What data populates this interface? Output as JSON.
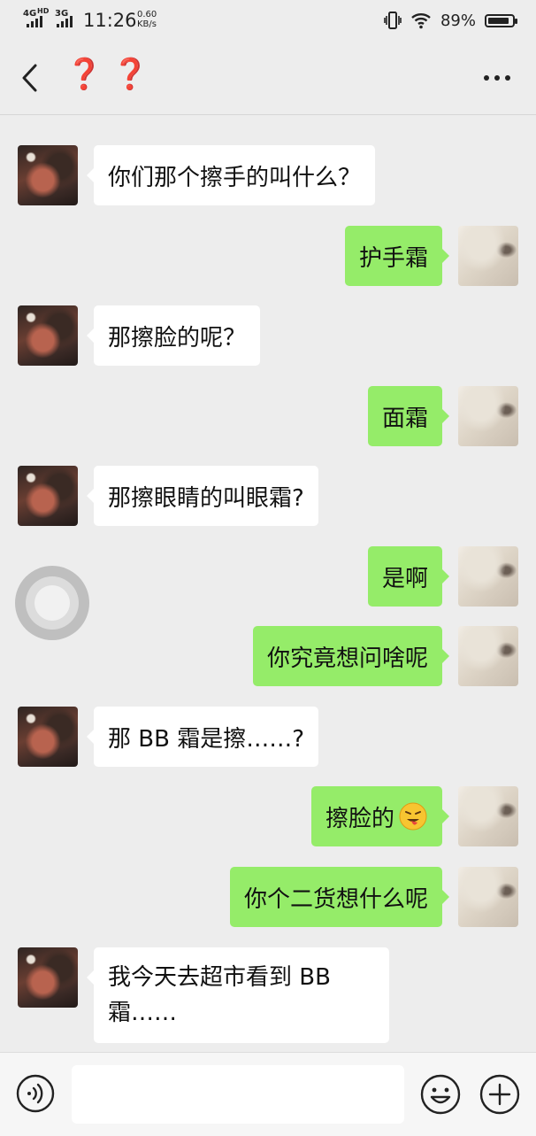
{
  "status_bar": {
    "network1": "4G",
    "network1_hd": "HD",
    "network2": "3G",
    "time": "11:26",
    "speed_value": "0.60",
    "speed_unit": "KB/s",
    "battery_pct": "89%",
    "battery_level": 0.89
  },
  "header": {
    "title": "❓❓",
    "back_icon": "chevron-left-icon",
    "more_icon": "more-dots-icon"
  },
  "messages": [
    {
      "side": "in",
      "text": "你们那个擦手的叫什么？"
    },
    {
      "side": "out",
      "text": "护手霜"
    },
    {
      "side": "in",
      "text": "那擦脸的呢？"
    },
    {
      "side": "out",
      "text": "面霜"
    },
    {
      "side": "in",
      "text": "那擦眼睛的叫眼霜?"
    },
    {
      "side": "out",
      "text": "是啊"
    },
    {
      "side": "out",
      "text": "你究竟想问啥呢"
    },
    {
      "side": "in",
      "text": "那 BB 霜是擦……?"
    },
    {
      "side": "out",
      "text": "擦脸的",
      "emoji": "grimacing-tongue-emoji"
    },
    {
      "side": "out",
      "text": "你个二货想什么呢"
    },
    {
      "side": "in",
      "text": "我今天去超市看到 BB 霜……"
    }
  ],
  "input_bar": {
    "voice_icon": "voice-icon",
    "text_value": "",
    "emoji_icon": "smile-icon",
    "plus_icon": "plus-icon"
  },
  "colors": {
    "background": "#ededed",
    "out_bubble": "#95ec69",
    "in_bubble": "#ffffff",
    "title_red": "#d42626"
  }
}
